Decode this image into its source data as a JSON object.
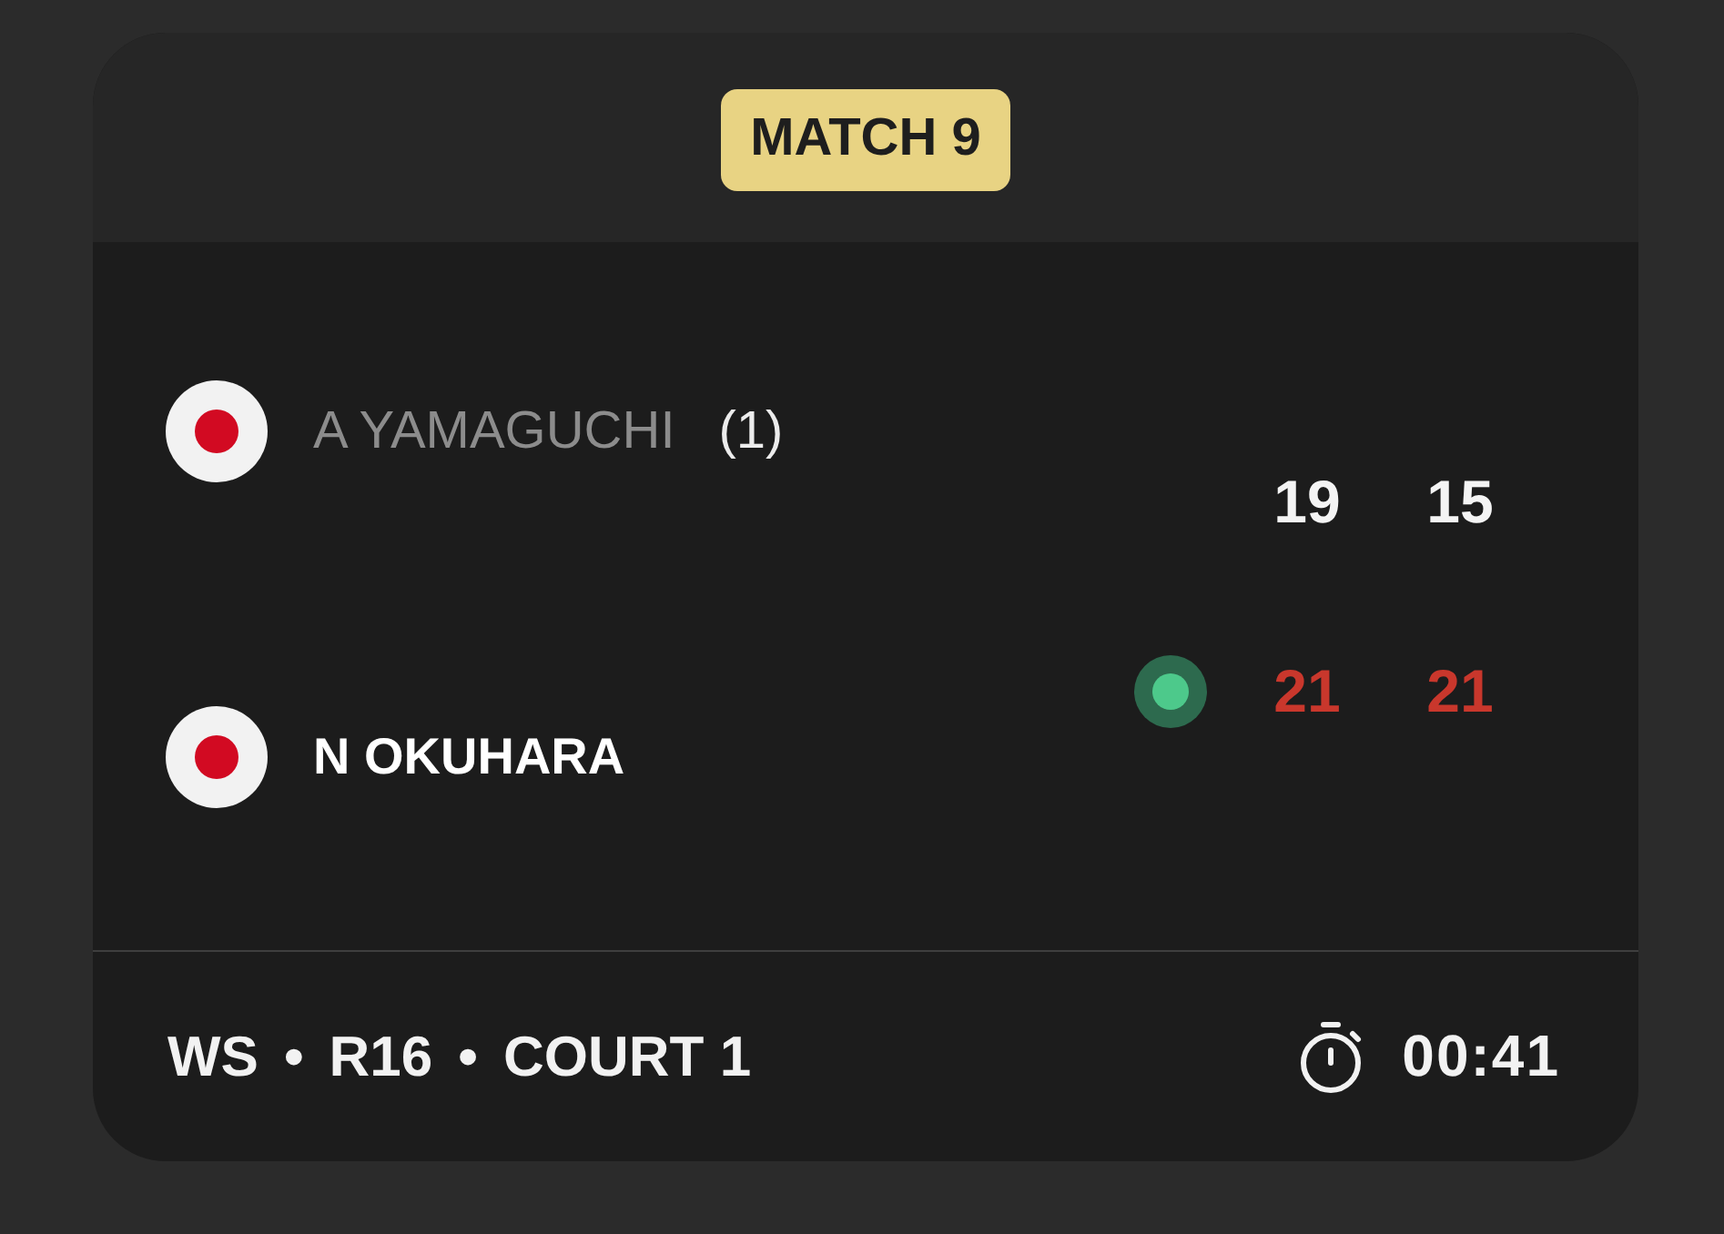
{
  "match": {
    "label": "MATCH 9"
  },
  "players": [
    {
      "name": "A YAMAGUCHI",
      "seed": "(1)",
      "winner": false,
      "serving": false,
      "scores": [
        "19",
        "15"
      ]
    },
    {
      "name": "N OKUHARA",
      "winner": true,
      "serving": true,
      "scores": [
        "21",
        "21"
      ]
    }
  ],
  "footer": {
    "details": [
      "WS",
      "•",
      "R16",
      "•",
      "COURT 1"
    ],
    "duration": "00:41"
  }
}
